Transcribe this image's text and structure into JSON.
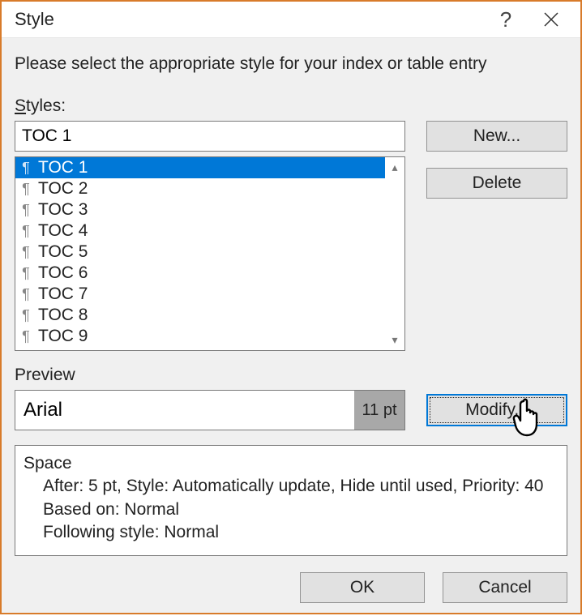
{
  "title": "Style",
  "instruction": "Please select the appropriate style for your index or table entry",
  "labels": {
    "styles": "Styles:",
    "preview": "Preview"
  },
  "input_value": "TOC 1",
  "styles_list": [
    "TOC 1",
    "TOC 2",
    "TOC 3",
    "TOC 4",
    "TOC 5",
    "TOC 6",
    "TOC 7",
    "TOC 8",
    "TOC 9"
  ],
  "selected_index": 0,
  "buttons": {
    "new": "New...",
    "delete": "Delete",
    "modify": "Modify...",
    "ok": "OK",
    "cancel": "Cancel"
  },
  "preview": {
    "font": "Arial",
    "size": "11 pt"
  },
  "description": {
    "heading": "Space",
    "line1": "After:  5 pt, Style: Automatically update, Hide until used, Priority: 40",
    "line2": "Based on: Normal",
    "line3": "Following style: Normal"
  }
}
